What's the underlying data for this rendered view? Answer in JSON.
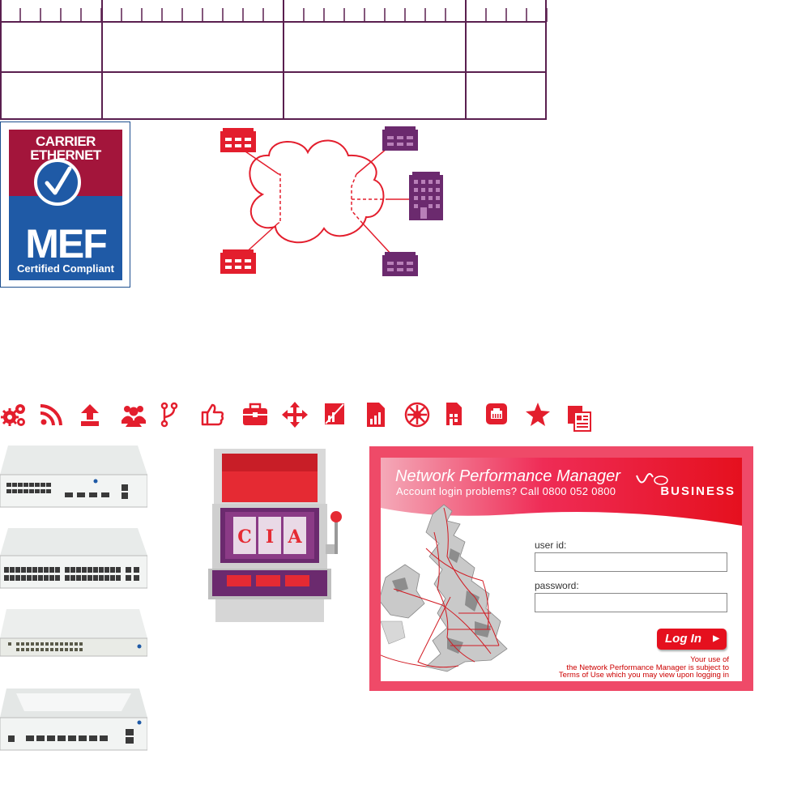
{
  "mef_badge": {
    "line1": "CARRIER",
    "line2": "ETHERNET",
    "brand": "MEF",
    "caption": "Certified Compliant",
    "colors": {
      "top": "#a3153b",
      "bottom": "#1f5aa6"
    }
  },
  "diagram": {
    "sites": [
      "red-building",
      "purple-building",
      "purple-tower"
    ],
    "colors": {
      "red": "#e31e2d",
      "purple": "#6b2a6e"
    }
  },
  "icons": [
    "gears-icon",
    "rss-icon",
    "upload-icon",
    "users-icon",
    "code-fork-icon",
    "thumbs-up-icon",
    "briefcase-icon",
    "move-arrows-icon",
    "document-chart-icon",
    "report-chart-icon",
    "network-hub-icon",
    "building-document-icon",
    "ethernet-port-icon",
    "star-icon",
    "documents-stack-icon"
  ],
  "slot_machine": {
    "reels": [
      "C",
      "I",
      "A"
    ]
  },
  "login": {
    "title": "Network Performance Manager",
    "subtitle": "Account login problems? Call 0800 052 0800",
    "brand": "BUSINESS",
    "user_label": "user id:",
    "password_label": "password:",
    "user_value": "",
    "password_value": "",
    "button_label": "Log In",
    "terms_line1": "Your use of",
    "terms_line2": "the Network Performance Manager is subject to",
    "terms_line3": "Terms of Use which you may view upon logging in",
    "accent_color": "#e5101e"
  }
}
